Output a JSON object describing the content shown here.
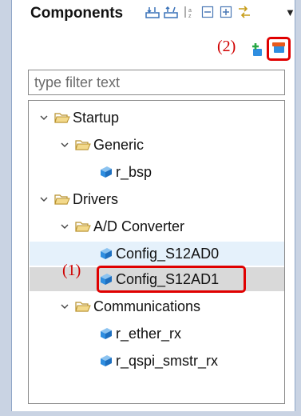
{
  "panel": {
    "title": "Components",
    "toolbar_icons": [
      "collapse-all-icon",
      "expand-all-icon",
      "sort-icon",
      "collapse-icon",
      "expand-icon",
      "sync-icon"
    ],
    "menu_glyph": "▼"
  },
  "annotations": {
    "label_1": "(1)",
    "label_2": "(2)",
    "color": "#e00000"
  },
  "actions": {
    "add_icon": "add-component-icon",
    "remove_icon": "remove-component-icon"
  },
  "filter": {
    "placeholder": "type filter text"
  },
  "tree": {
    "startup": "Startup",
    "generic": "Generic",
    "r_bsp": "r_bsp",
    "drivers": "Drivers",
    "ad_converter": "A/D Converter",
    "config_s12ad0": "Config_S12AD0",
    "config_s12ad1": "Config_S12AD1",
    "communications": "Communications",
    "r_ether_rx": "r_ether_rx",
    "r_qspi_smstr_rx": "r_qspi_smstr_rx"
  },
  "colors": {
    "selection": "#d9d9d9",
    "hover": "#e5f1fb",
    "folder": "#e8c76a",
    "component": "#2f8ee0"
  }
}
